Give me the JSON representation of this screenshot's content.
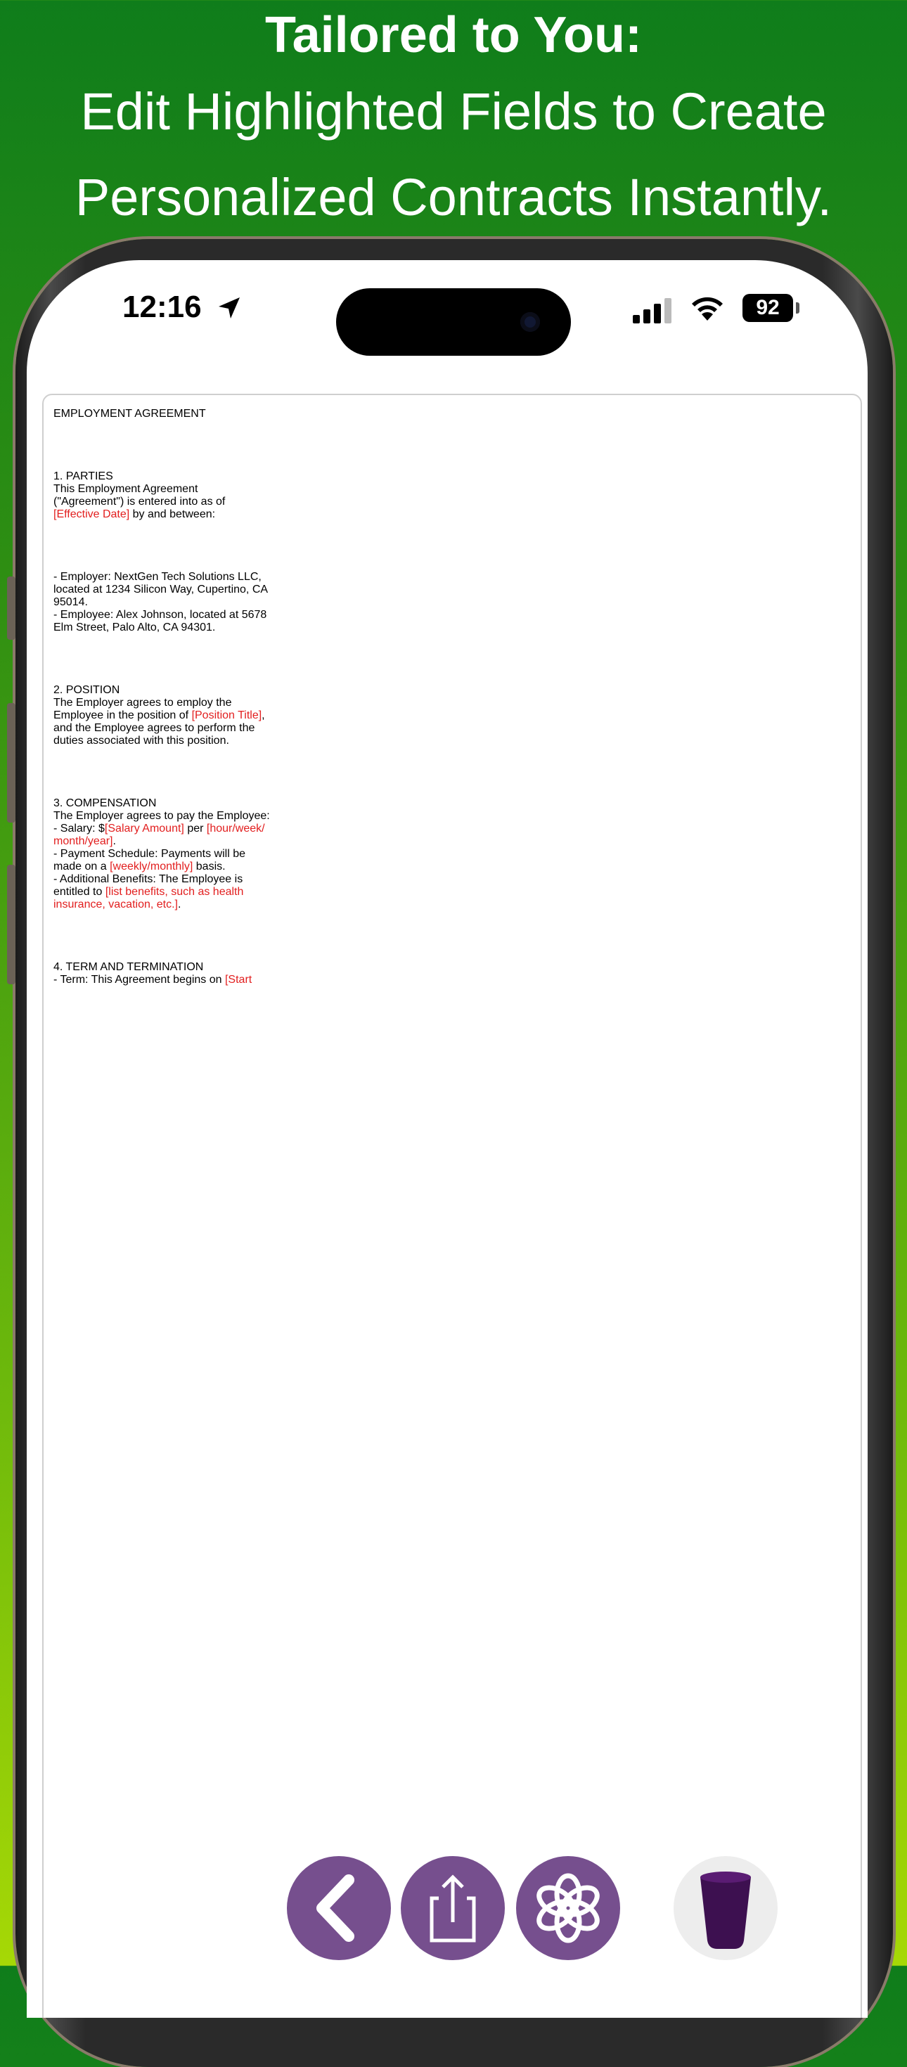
{
  "promo": {
    "headline": "Tailored to You:",
    "line1": "Edit Highlighted Fields to Create",
    "line2": "Personalized Contracts Instantly."
  },
  "status_bar": {
    "time": "12:16",
    "battery": "92"
  },
  "document": {
    "title": "EMPLOYMENT AGREEMENT",
    "parties_heading": "1. PARTIES",
    "parties_l1": "This Employment Agreement",
    "parties_l2": "(\"Agreement\") is entered into as of",
    "effective_date": "[Effective Date]",
    "parties_l3_rest": " by and between:",
    "employer_l1": "- Employer: NextGen Tech Solutions LLC,",
    "employer_l2": "located at 1234 Silicon Way, Cupertino, CA",
    "employer_l3": "95014.",
    "employee_l1": "- Employee: Alex Johnson, located at 5678",
    "employee_l2": "Elm Street, Palo Alto, CA 94301.",
    "position_heading": "2. POSITION",
    "position_l1": "The Employer agrees to employ the",
    "position_l2_a": "Employee in the position of ",
    "position_title": "[Position Title]",
    "position_l2_b": ",",
    "position_l3": "and the Employee agrees to perform the",
    "position_l4": "duties associated with this position.",
    "comp_heading": "3. COMPENSATION",
    "comp_l1": "The Employer agrees to pay the Employee:",
    "salary_a": "- Salary: $",
    "salary_amount": "[Salary Amount]",
    "salary_b": " per ",
    "salary_period_1": "[hour/week/",
    "salary_period_2": "month/year]",
    "salary_c": ".",
    "schedule_l1": "- Payment Schedule: Payments will be",
    "schedule_l2_a": "made on a ",
    "schedule_value": "[weekly/monthly]",
    "schedule_l2_b": " basis.",
    "benefits_l1": "- Additional Benefits: The Employee is",
    "benefits_l2_a": "entitled to ",
    "benefits_value_1": "[list benefits, such as health",
    "benefits_value_2": "insurance, vacation, etc.]",
    "benefits_l3_b": ".",
    "term_heading": "4. TERM AND TERMINATION",
    "term_l1_a": "- Term: This Agreement begins on ",
    "term_start": "[Start"
  },
  "toolbar": {
    "icons": [
      "back-icon",
      "share-icon",
      "openai-icon",
      "trash-icon"
    ]
  }
}
